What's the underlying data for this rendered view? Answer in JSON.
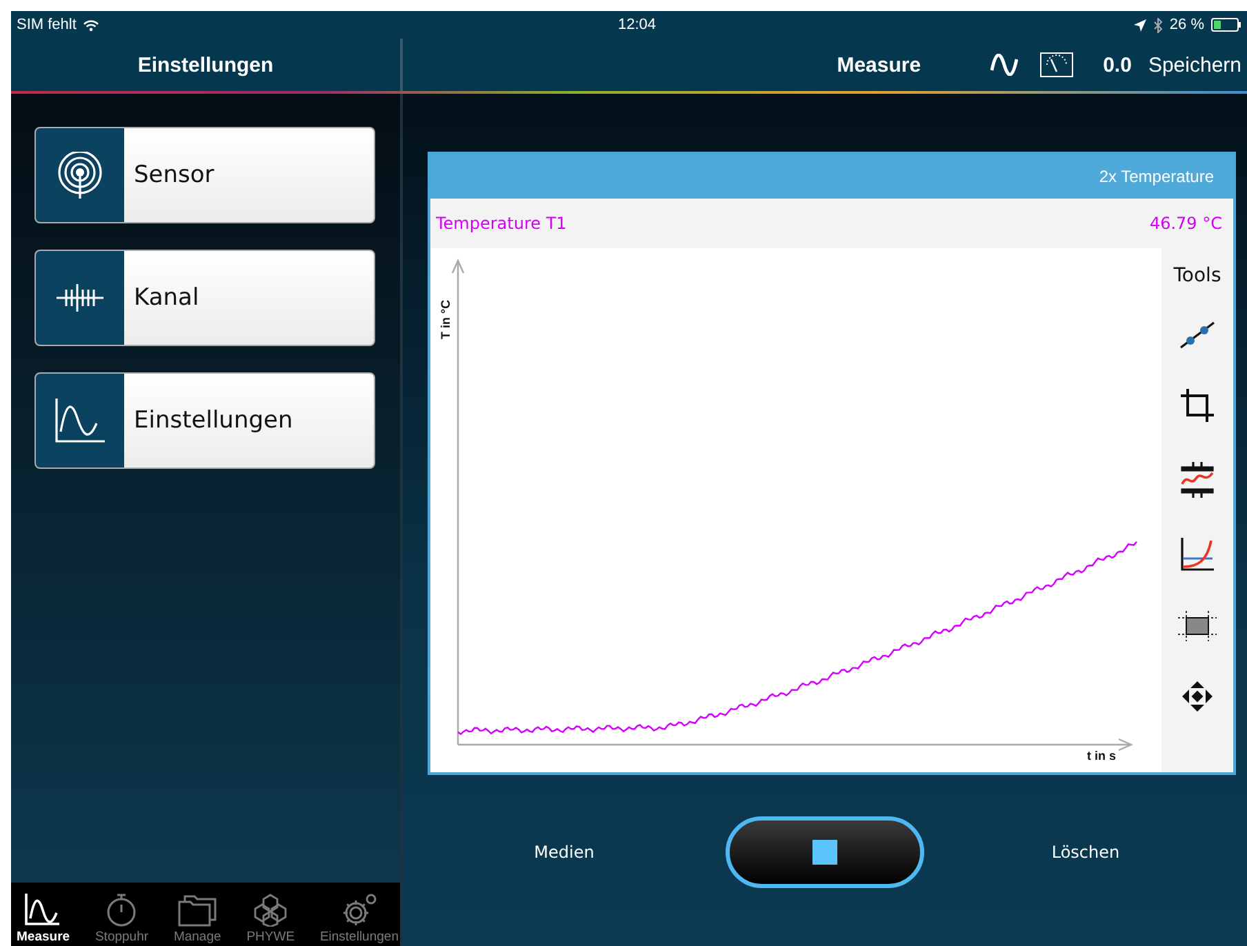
{
  "status_bar": {
    "carrier": "SIM fehlt",
    "time": "12:04",
    "battery": "26 %"
  },
  "nav": {
    "left_title": "Einstellungen",
    "title": "Measure",
    "value": "0.0",
    "save": "Speichern"
  },
  "menu": [
    {
      "kind": "sensor",
      "label": "Sensor"
    },
    {
      "kind": "channel",
      "label": "Kanal"
    },
    {
      "kind": "settings",
      "label": "Einstellungen"
    }
  ],
  "chart_panel": {
    "title": "2x Temperature",
    "channel": "Temperature T1",
    "reading": "46.79 °C",
    "ylabel": "T in °C",
    "xlabel": "t in s",
    "tools_title": "Tools",
    "tools": [
      {
        "kind": "line-fit"
      },
      {
        "kind": "crop"
      },
      {
        "kind": "filter"
      },
      {
        "kind": "curve-fit"
      },
      {
        "kind": "area"
      },
      {
        "kind": "move"
      }
    ]
  },
  "controls": {
    "left": "Medien",
    "right": "Löschen",
    "running": true
  },
  "tab_bar": [
    {
      "kind": "measure",
      "label": "Measure",
      "selected": true
    },
    {
      "kind": "stopwatch",
      "label": "Stoppuhr",
      "selected": false
    },
    {
      "kind": "folder",
      "label": "Manage",
      "selected": false
    },
    {
      "kind": "phywe",
      "label": "PHYWE",
      "selected": false
    },
    {
      "kind": "gear",
      "label": "Einstellungen",
      "selected": false
    }
  ]
}
